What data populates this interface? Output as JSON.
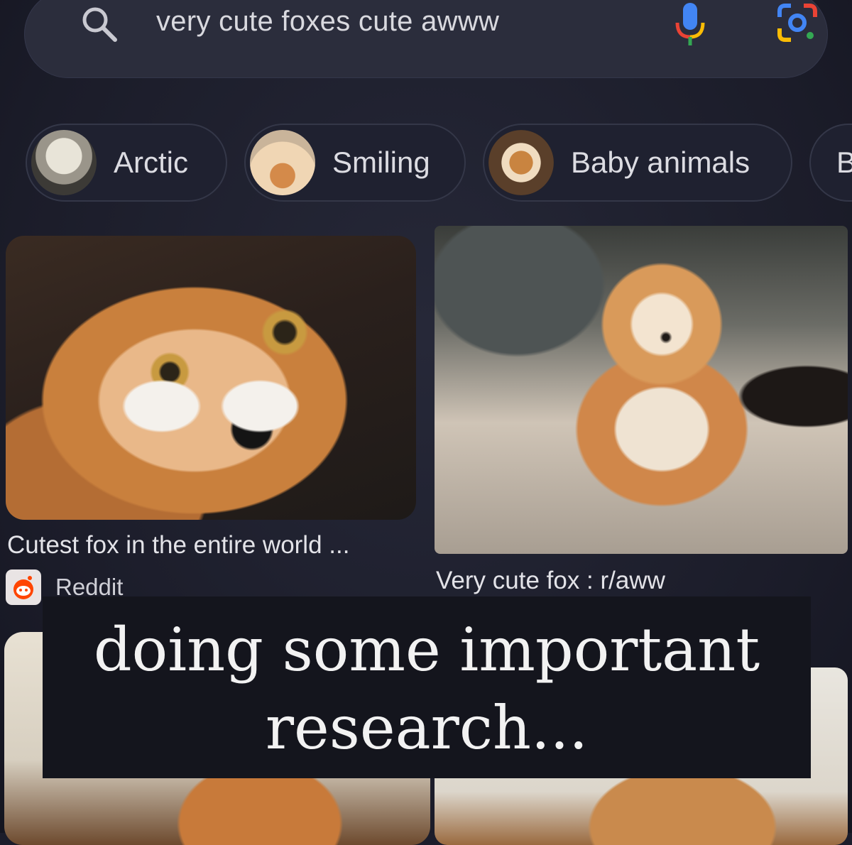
{
  "search": {
    "query": "very cute foxes cute awww"
  },
  "chips": [
    {
      "label": "Arctic"
    },
    {
      "label": "Smiling"
    },
    {
      "label": "Baby animals"
    },
    {
      "label": "B"
    }
  ],
  "results": [
    {
      "title": "Cutest fox in the entire world ...",
      "source": "Reddit"
    },
    {
      "title": "Very cute fox : r/aww"
    }
  ],
  "overlay": {
    "line1": "doing some important",
    "line2": "research..."
  },
  "icons": {
    "search": "search-icon",
    "mic": "mic-icon",
    "lens": "lens-icon",
    "reddit": "reddit-icon"
  },
  "colors": {
    "background": "#1c1d2b",
    "searchbar": "#2b2d3c",
    "text": "#e3e3e8"
  }
}
